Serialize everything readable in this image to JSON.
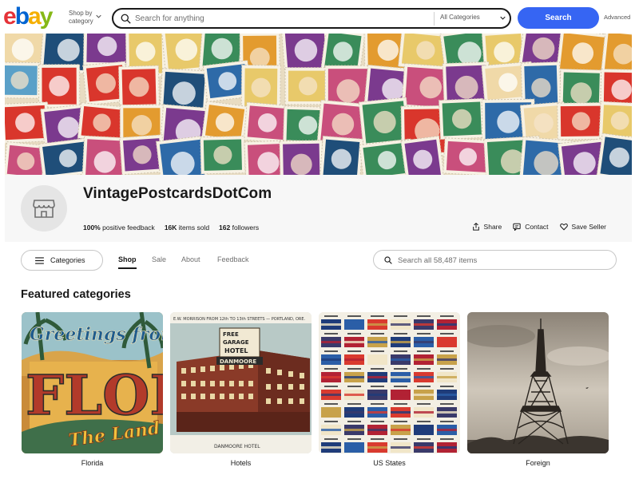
{
  "brand": {
    "logo_letters": [
      "e",
      "b",
      "a",
      "y"
    ],
    "logo_colors": [
      "#e53238",
      "#0064d2",
      "#f5af02",
      "#86b817"
    ],
    "accent": "#3665f3"
  },
  "header": {
    "shop_by_category": "Shop by category",
    "search_placeholder": "Search for anything",
    "category_select": "All Categories",
    "search_button": "Search",
    "advanced_link": "Advanced"
  },
  "store": {
    "name": "VintagePostcardsDotCom",
    "avatar_icon": "storefront-icon",
    "feedback": "100%",
    "feedback_label": "positive feedback",
    "items_sold": "16K",
    "items_sold_label": "items sold",
    "followers": "162",
    "followers_label": "followers",
    "actions": {
      "share": "Share",
      "contact": "Contact",
      "save_seller": "Save Seller"
    }
  },
  "nav": {
    "categories_button": "Categories",
    "tabs": [
      "Shop",
      "Sale",
      "About",
      "Feedback"
    ],
    "active_tab": "Shop",
    "store_search_placeholder": "Search all 58,487 items"
  },
  "featured": {
    "title": "Featured categories",
    "categories": [
      {
        "label": "Florida"
      },
      {
        "label": "Hotels"
      },
      {
        "label": "US States"
      },
      {
        "label": "Foreign"
      }
    ]
  }
}
